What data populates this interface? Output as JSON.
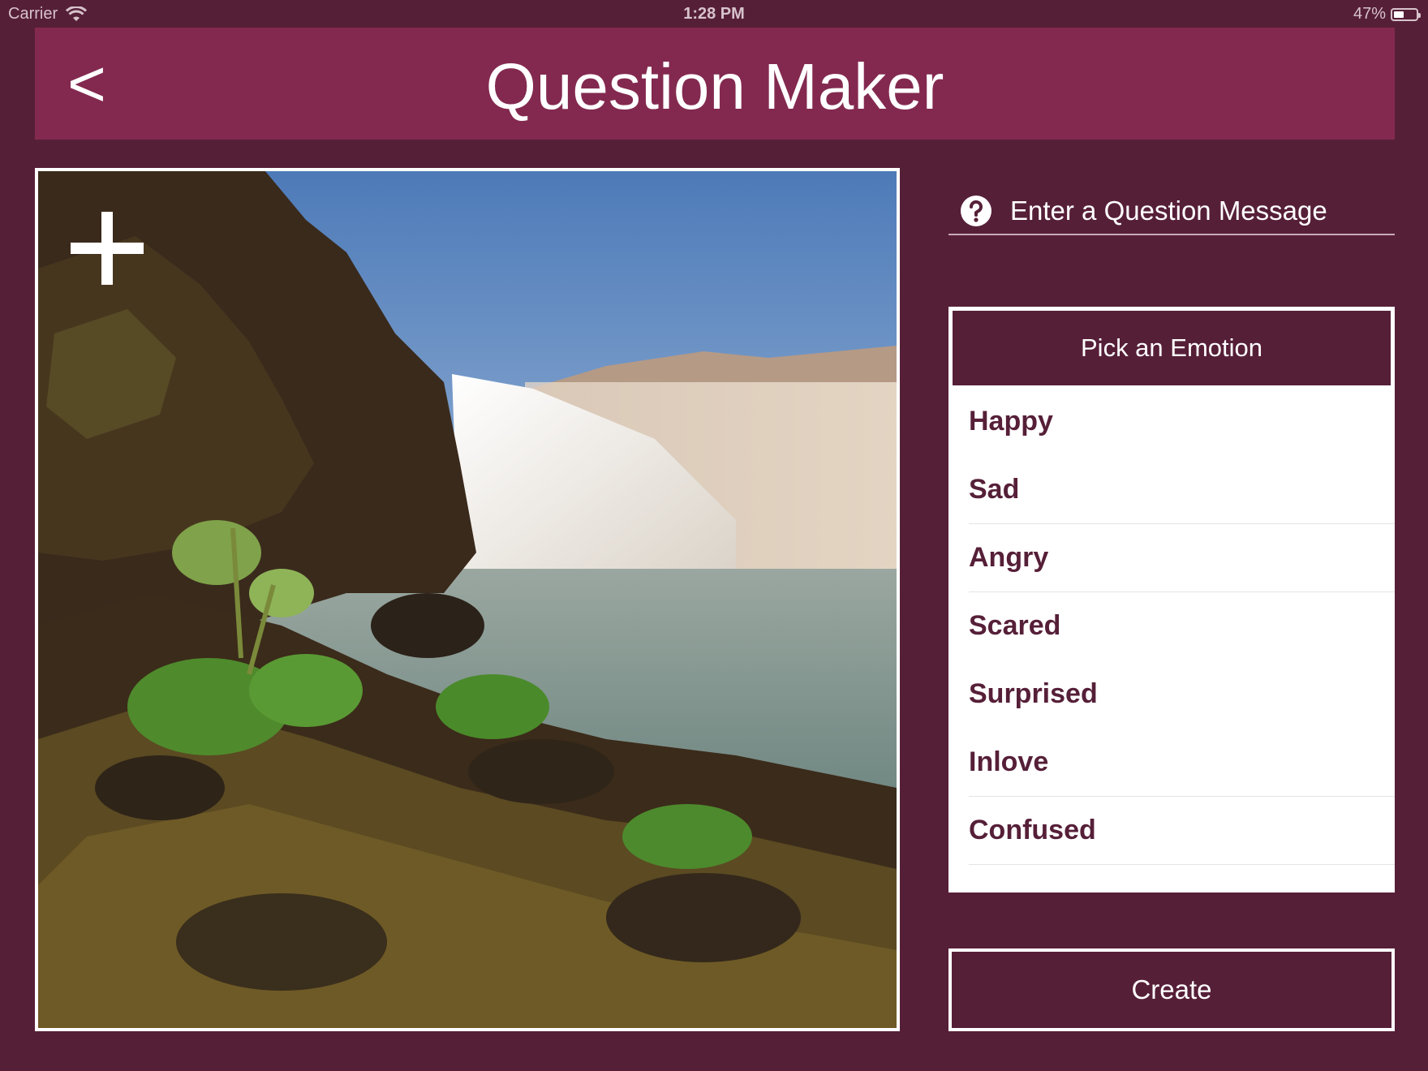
{
  "status_bar": {
    "carrier": "Carrier",
    "time": "1:28 PM",
    "battery_percent": "47%",
    "battery_level": 0.47,
    "icons": [
      "wifi-icon",
      "battery-icon"
    ]
  },
  "header": {
    "back_label": "<",
    "title": "Question Maker"
  },
  "image_panel": {
    "add_icon": "plus-icon",
    "photo_description_icon": "landscape-photo"
  },
  "question": {
    "placeholder": "Enter a Question Message",
    "icon": "help-circle-icon"
  },
  "emotion_picker": {
    "title": "Pick an Emotion",
    "options": [
      {
        "label": "Happy"
      },
      {
        "label": "Sad"
      },
      {
        "label": "Angry"
      },
      {
        "label": "Scared"
      },
      {
        "label": "Surprised"
      },
      {
        "label": "Inlove"
      },
      {
        "label": "Confused"
      }
    ]
  },
  "create_button": {
    "label": "Create"
  },
  "colors": {
    "background": "#561f38",
    "header": "#83294f",
    "accent_text": "#561f38",
    "white": "#ffffff"
  }
}
